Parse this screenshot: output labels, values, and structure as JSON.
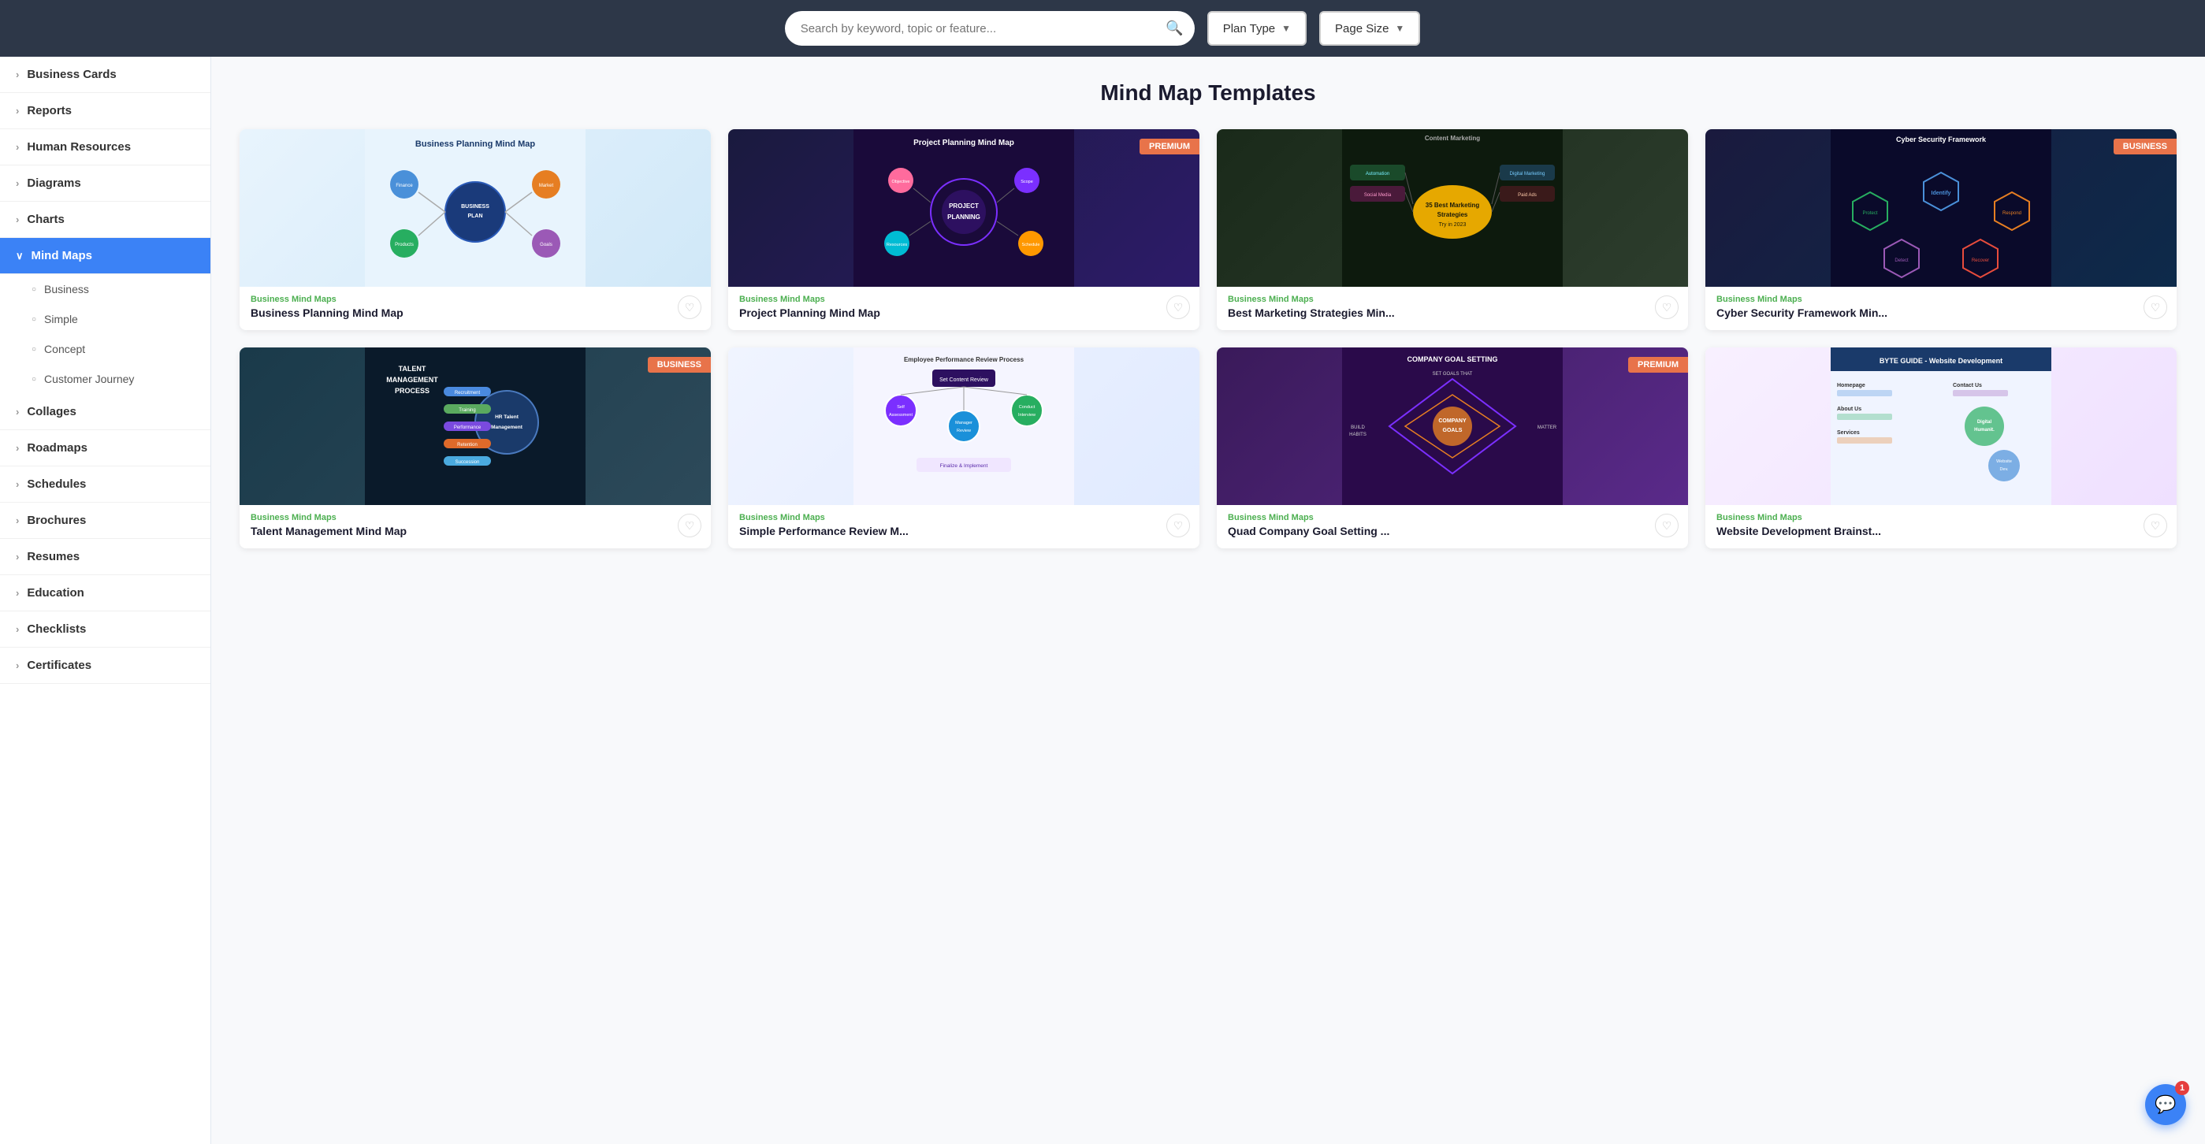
{
  "topbar": {
    "search_placeholder": "Search by keyword, topic or feature...",
    "plan_type_label": "Plan Type",
    "page_size_label": "Page Size"
  },
  "sidebar": {
    "items": [
      {
        "id": "business-cards",
        "label": "Business Cards",
        "expanded": false,
        "active": false
      },
      {
        "id": "reports",
        "label": "Reports",
        "expanded": false,
        "active": false
      },
      {
        "id": "human-resources",
        "label": "Human Resources",
        "expanded": false,
        "active": false
      },
      {
        "id": "diagrams",
        "label": "Diagrams",
        "expanded": false,
        "active": false
      },
      {
        "id": "charts",
        "label": "Charts",
        "expanded": false,
        "active": false
      },
      {
        "id": "mind-maps",
        "label": "Mind Maps",
        "expanded": true,
        "active": true
      },
      {
        "id": "collages",
        "label": "Collages",
        "expanded": false,
        "active": false
      },
      {
        "id": "roadmaps",
        "label": "Roadmaps",
        "expanded": false,
        "active": false
      },
      {
        "id": "schedules",
        "label": "Schedules",
        "expanded": false,
        "active": false
      },
      {
        "id": "brochures",
        "label": "Brochures",
        "expanded": false,
        "active": false
      },
      {
        "id": "resumes",
        "label": "Resumes",
        "expanded": false,
        "active": false
      },
      {
        "id": "education",
        "label": "Education",
        "expanded": false,
        "active": false
      },
      {
        "id": "checklists",
        "label": "Checklists",
        "expanded": false,
        "active": false
      },
      {
        "id": "certificates",
        "label": "Certificates",
        "expanded": false,
        "active": false
      }
    ],
    "sub_items": [
      {
        "label": "Business"
      },
      {
        "label": "Simple"
      },
      {
        "label": "Concept"
      },
      {
        "label": "Customer Journey"
      }
    ]
  },
  "page": {
    "title": "Mind Map Templates"
  },
  "templates": [
    {
      "id": 1,
      "category": "Business Mind Maps",
      "name": "Business Planning Mind Map",
      "badge": null,
      "thumb_style": "1"
    },
    {
      "id": 2,
      "category": "Business Mind Maps",
      "name": "Project Planning Mind Map",
      "badge": "PREMIUM",
      "badge_type": "premium",
      "thumb_style": "2"
    },
    {
      "id": 3,
      "category": "Business Mind Maps",
      "name": "Best Marketing Strategies Min...",
      "badge": null,
      "thumb_style": "3"
    },
    {
      "id": 4,
      "category": "Business Mind Maps",
      "name": "Cyber Security Framework Min...",
      "badge": "BUSINESS",
      "badge_type": "business",
      "thumb_style": "4"
    },
    {
      "id": 5,
      "category": "Business Mind Maps",
      "name": "Talent Management Mind Map",
      "badge": "BUSINESS",
      "badge_type": "business",
      "thumb_style": "5"
    },
    {
      "id": 6,
      "category": "Business Mind Maps",
      "name": "Simple Performance Review M...",
      "badge": null,
      "thumb_style": "6"
    },
    {
      "id": 7,
      "category": "Business Mind Maps",
      "name": "Quad Company Goal Setting ...",
      "badge": "PREMIUM",
      "badge_type": "premium",
      "thumb_style": "7"
    },
    {
      "id": 8,
      "category": "Business Mind Maps",
      "name": "Website Development Brainst...",
      "badge": null,
      "thumb_style": "8"
    }
  ],
  "chat": {
    "badge_count": "1",
    "icon": "💬"
  }
}
